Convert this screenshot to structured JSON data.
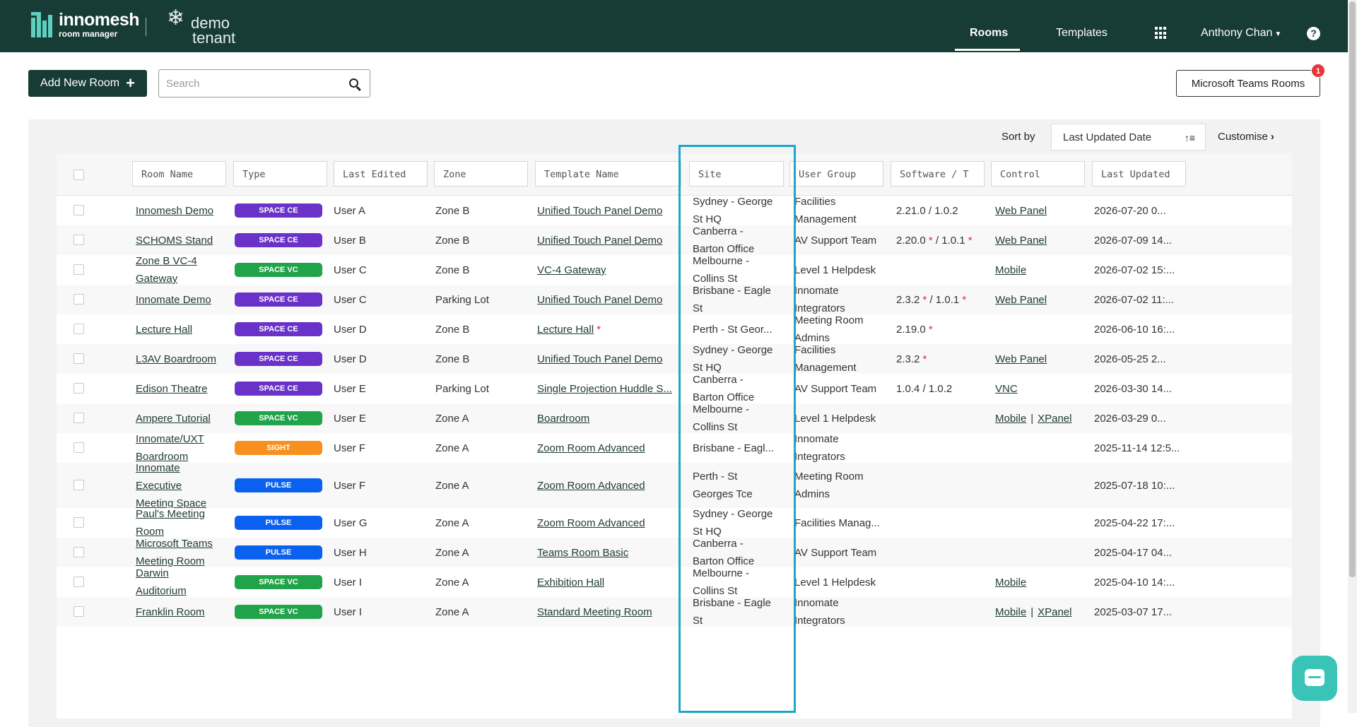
{
  "header": {
    "brand_name": "innomesh",
    "brand_sub": "room manager",
    "tenant_line1": "demo",
    "tenant_line2": "tenant",
    "nav": {
      "rooms": "Rooms",
      "templates": "Templates"
    },
    "user_name": "Anthony Chan",
    "help": "?"
  },
  "toolbar": {
    "add_room": "Add New Room",
    "search_placeholder": "Search",
    "teams_button": "Microsoft Teams Rooms",
    "teams_badge": "1"
  },
  "sort": {
    "label": "Sort by",
    "selected": "Last Updated Date",
    "customise": "Customise"
  },
  "columns": {
    "room_name": "Room Name",
    "type": "Type",
    "last_edited": "Last Edited",
    "zone": "Zone",
    "template_name": "Template Name",
    "site": "Site",
    "user_group": "User Group",
    "software": "Software / T",
    "control": "Control",
    "last_updated": "Last Updated"
  },
  "badge_colors": {
    "SPACE CE": "#6a32c9",
    "SPACE VC": "#21a34a",
    "SIGHT": "#f7901e",
    "PULSE": "#0a61f0"
  },
  "rows": [
    {
      "room": [
        "Innomesh Demo"
      ],
      "type": "SPACE CE",
      "edited": "User A",
      "zone": "Zone B",
      "template": "Unified Touch Panel Demo",
      "template_star": "",
      "site": [
        "Sydney - George",
        "St HQ"
      ],
      "group": [
        "Facilities",
        "Management"
      ],
      "software": "2.21.0 / 1.0.2",
      "control": [
        "Web Panel"
      ],
      "updated": "2026-07-20 0..."
    },
    {
      "room": [
        "SCHOMS Stand"
      ],
      "type": "SPACE CE",
      "edited": "User B",
      "zone": "Zone B",
      "template": "Unified Touch Panel Demo",
      "template_star": "",
      "site": [
        "Canberra -",
        "Barton Office"
      ],
      "group": [
        "AV Support Team"
      ],
      "software": "2.20.0 * / 1.0.1 *",
      "control": [
        "Web Panel"
      ],
      "updated": "2026-07-09 14..."
    },
    {
      "room": [
        "Zone B VC-4",
        "Gateway"
      ],
      "type": "SPACE VC",
      "edited": "User C",
      "zone": "Zone B",
      "template": "VC-4 Gateway",
      "template_star": "",
      "site": [
        "Melbourne -",
        "Collins St"
      ],
      "group": [
        "Level 1 Helpdesk"
      ],
      "software": "",
      "control": [
        "Mobile"
      ],
      "updated": "2026-07-02 15:..."
    },
    {
      "room": [
        "Innomate Demo"
      ],
      "type": "SPACE CE",
      "edited": "User C",
      "zone": "Parking Lot",
      "template": "Unified Touch Panel Demo",
      "template_star": "",
      "site": [
        "Brisbane - Eagle",
        "St"
      ],
      "group": [
        "Innomate",
        "Integrators"
      ],
      "software": "2.3.2 * / 1.0.1 *",
      "control": [
        "Web Panel"
      ],
      "updated": "2026-07-02 11:..."
    },
    {
      "room": [
        "Lecture Hall"
      ],
      "type": "SPACE CE",
      "edited": "User D",
      "zone": "Zone B",
      "template": "Lecture Hall",
      "template_star": "*",
      "site": [
        "Perth - St Geor..."
      ],
      "group": [
        "Meeting Room",
        "Admins"
      ],
      "software": "2.19.0 *",
      "control": [],
      "updated": "2026-06-10 16:..."
    },
    {
      "room": [
        "L3AV Boardroom"
      ],
      "type": "SPACE CE",
      "edited": "User D",
      "zone": "Zone B",
      "template": "Unified Touch Panel Demo",
      "template_star": "",
      "site": [
        "Sydney - George",
        "St HQ"
      ],
      "group": [
        "Facilities",
        "Management"
      ],
      "software": "2.3.2 *",
      "control": [
        "Web Panel"
      ],
      "updated": "2026-05-25 2..."
    },
    {
      "room": [
        "Edison Theatre"
      ],
      "type": "SPACE CE",
      "edited": "User E",
      "zone": "Parking Lot",
      "template": "Single Projection Huddle S...",
      "template_star": "",
      "site": [
        "Canberra -",
        "Barton Office"
      ],
      "group": [
        "AV Support Team"
      ],
      "software": "1.0.4 / 1.0.2",
      "control": [
        "VNC"
      ],
      "updated": "2026-03-30 14..."
    },
    {
      "room": [
        "Ampere Tutorial"
      ],
      "type": "SPACE VC",
      "edited": "User E",
      "zone": "Zone A",
      "template": "Boardroom",
      "template_star": "",
      "site": [
        "Melbourne -",
        "Collins St"
      ],
      "group": [
        "Level 1 Helpdesk"
      ],
      "software": "",
      "control": [
        "Mobile",
        "XPanel"
      ],
      "updated": "2026-03-29 0..."
    },
    {
      "room": [
        "Innomate/UXT",
        "Boardroom"
      ],
      "type": "SIGHT",
      "edited": "User F",
      "zone": "Zone A",
      "template": "Zoom Room Advanced",
      "template_star": "",
      "site": [
        "Brisbane - Eagl..."
      ],
      "group": [
        "Innomate",
        "Integrators"
      ],
      "software": "",
      "control": [],
      "updated": "2025-11-14 12:5..."
    },
    {
      "room": [
        "Innomate",
        "Executive",
        "Meeting Space"
      ],
      "type": "PULSE",
      "edited": "User F",
      "zone": "Zone A",
      "template": "Zoom Room Advanced",
      "template_star": "",
      "site": [
        "Perth - St",
        "Georges Tce"
      ],
      "group": [
        "Meeting Room",
        "Admins"
      ],
      "software": "",
      "control": [],
      "updated": "2025-07-18 10:..."
    },
    {
      "room": [
        "Paul's Meeting",
        "Room"
      ],
      "type": "PULSE",
      "edited": "User G",
      "zone": "Zone A",
      "template": "Zoom Room Advanced",
      "template_star": "",
      "site": [
        "Sydney - George",
        "St HQ"
      ],
      "group": [
        "Facilities Manag..."
      ],
      "software": "",
      "control": [],
      "updated": "2025-04-22 17:..."
    },
    {
      "room": [
        "Microsoft Teams",
        "Meeting Room"
      ],
      "type": "PULSE",
      "edited": "User H",
      "zone": "Zone A",
      "template": "Teams Room Basic",
      "template_star": "",
      "site": [
        "Canberra -",
        "Barton Office"
      ],
      "group": [
        "AV Support Team"
      ],
      "software": "",
      "control": [],
      "updated": "2025-04-17 04..."
    },
    {
      "room": [
        "Darwin",
        "Auditorium"
      ],
      "type": "SPACE VC",
      "edited": "User I",
      "zone": "Zone A",
      "template": "Exhibition Hall",
      "template_star": "",
      "site": [
        "Melbourne -",
        "Collins St"
      ],
      "group": [
        "Level 1 Helpdesk"
      ],
      "software": "",
      "control": [
        "Mobile"
      ],
      "updated": "2025-04-10 14:..."
    },
    {
      "room": [
        "Franklin Room"
      ],
      "type": "SPACE VC",
      "edited": "User I",
      "zone": "Zone A",
      "template": "Standard Meeting Room",
      "template_star": "",
      "site": [
        "Brisbane - Eagle",
        "St"
      ],
      "group": [
        "Innomate",
        "Integrators"
      ],
      "software": "",
      "control": [
        "Mobile",
        "XPanel"
      ],
      "updated": "2025-03-07 17..."
    }
  ]
}
